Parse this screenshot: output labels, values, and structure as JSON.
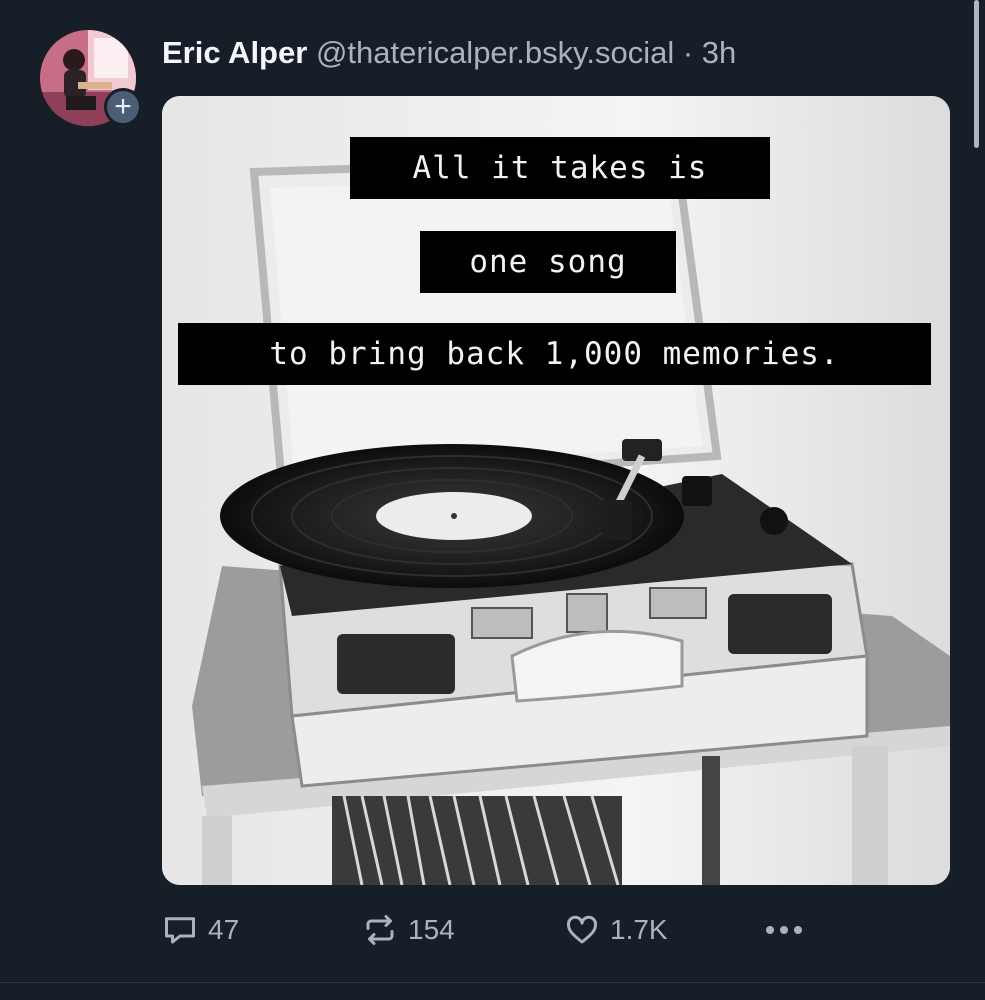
{
  "post": {
    "author_name": "Eric Alper",
    "handle": "@thatericalper.bsky.social",
    "separator": "·",
    "time": "3h",
    "avatar_icon": "avatar-photo",
    "follow_icon": "plus-icon",
    "follow_label": "+",
    "image": {
      "captions": [
        "All it takes is",
        "one song",
        "to bring back 1,000 memories."
      ],
      "subject": "record-player"
    },
    "actions": {
      "reply": {
        "icon": "reply-icon",
        "count": "47"
      },
      "repost": {
        "icon": "repost-icon",
        "count": "154"
      },
      "like": {
        "icon": "heart-icon",
        "count": "1.7K"
      },
      "more": {
        "icon": "more-icon"
      }
    }
  },
  "colors": {
    "background": "#161e27",
    "text_primary": "#f4f6f8",
    "text_secondary": "#a8b3bf",
    "badge": "#4b5e76"
  }
}
